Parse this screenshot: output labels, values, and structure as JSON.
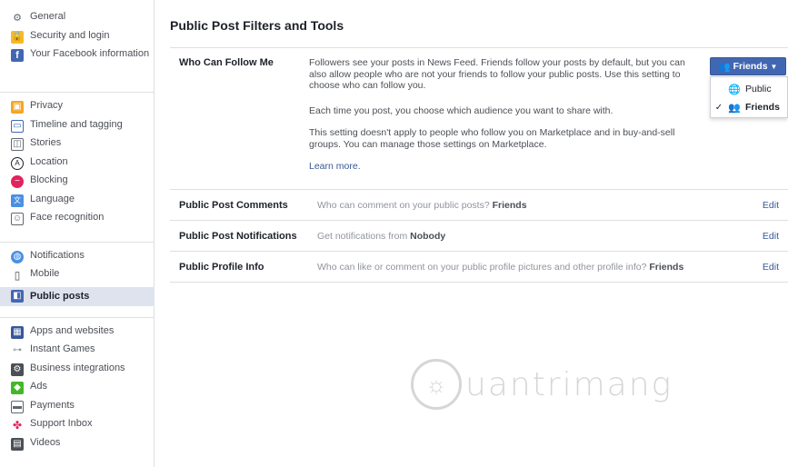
{
  "sidebar": {
    "groups": [
      [
        {
          "label": "General",
          "icon": "gear-icon"
        },
        {
          "label": "Security and login",
          "icon": "shield-icon"
        },
        {
          "label": "Your Facebook information",
          "icon": "facebook-icon"
        }
      ],
      [
        {
          "label": "Privacy",
          "icon": "lock-icon"
        },
        {
          "label": "Timeline and tagging",
          "icon": "timeline-icon"
        },
        {
          "label": "Stories",
          "icon": "book-icon"
        },
        {
          "label": "Location",
          "icon": "location-icon"
        },
        {
          "label": "Blocking",
          "icon": "blocking-icon"
        },
        {
          "label": "Language",
          "icon": "language-icon"
        },
        {
          "label": "Face recognition",
          "icon": "face-icon"
        }
      ],
      [
        {
          "label": "Notifications",
          "icon": "globe-icon"
        },
        {
          "label": "Mobile",
          "icon": "mobile-icon"
        },
        {
          "label": "Public posts",
          "icon": "rss-icon"
        }
      ],
      [
        {
          "label": "Apps and websites",
          "icon": "apps-icon"
        },
        {
          "label": "Instant Games",
          "icon": "gamepad-icon"
        },
        {
          "label": "Business integrations",
          "icon": "business-icon"
        },
        {
          "label": "Ads",
          "icon": "ads-icon"
        },
        {
          "label": "Payments",
          "icon": "card-icon"
        },
        {
          "label": "Support Inbox",
          "icon": "lifebuoy-icon"
        },
        {
          "label": "Videos",
          "icon": "film-icon"
        }
      ]
    ]
  },
  "page": {
    "title": "Public Post Filters and Tools"
  },
  "follow": {
    "label": "Who Can Follow Me",
    "para1": "Followers see your posts in News Feed. Friends follow your posts by default, but you can also allow people who are not your friends to follow your public posts. Use this setting to choose who can follow you.",
    "para2": "Each time you post, you choose which audience you want to share with.",
    "para3": "This setting doesn't apply to people who follow you on Marketplace and in buy-and-sell groups. You can manage those settings on Marketplace.",
    "learn_more": "Learn more.",
    "button_label": "Friends",
    "menu": [
      {
        "label": "Public",
        "icon": "globe-icon",
        "selected": false
      },
      {
        "label": "Friends",
        "icon": "friends-icon",
        "selected": true
      }
    ]
  },
  "rows": [
    {
      "label": "Public Post Comments",
      "text": "Who can comment on your public posts?",
      "value": "Friends",
      "edit": "Edit"
    },
    {
      "label": "Public Post Notifications",
      "text": "Get notifications from",
      "value": "Nobody",
      "edit": "Edit"
    },
    {
      "label": "Public Profile Info",
      "text": "Who can like or comment on your public profile pictures and other profile info?",
      "value": "Friends",
      "edit": "Edit"
    }
  ],
  "watermark": {
    "text": "uantrimang"
  },
  "colors": {
    "accent": "#4267b2",
    "link": "#385898",
    "active_bg": "#dfe3ee"
  }
}
